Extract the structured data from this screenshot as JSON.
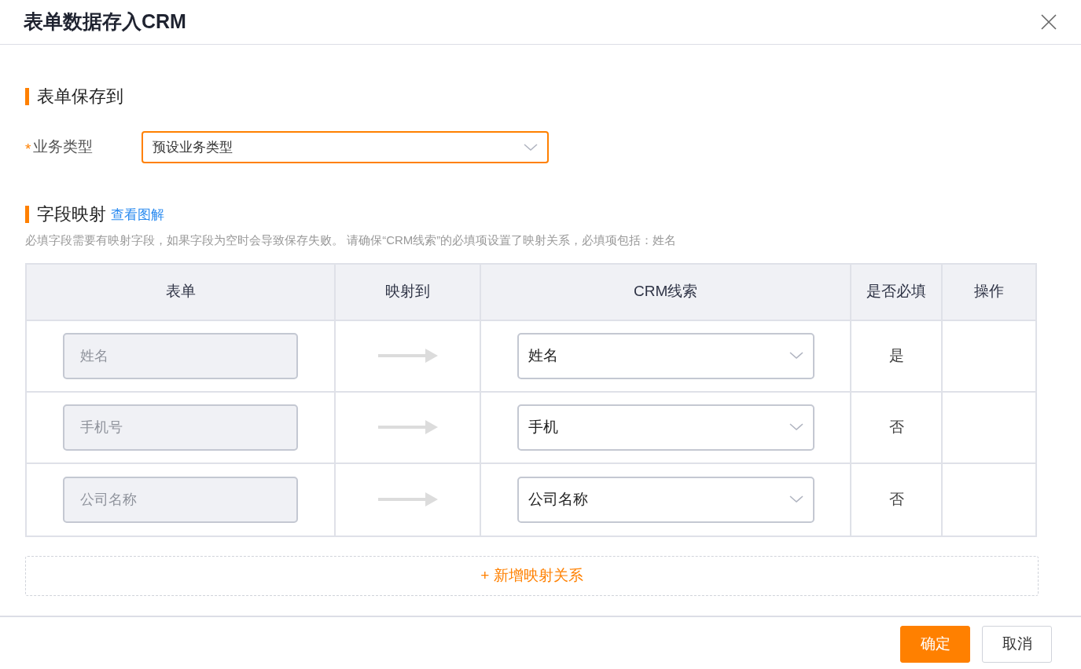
{
  "dialog": {
    "title": "表单数据存入CRM"
  },
  "save_section": {
    "heading": "表单保存到",
    "field": {
      "label": "业务类型",
      "required_mark": "*",
      "value": "预设业务类型",
      "focused": true
    }
  },
  "mapping_section": {
    "heading": "字段映射",
    "link": "查看图解",
    "note": "必填字段需要有映射字段，如果字段为空时会导致保存失败。 请确保“CRM线索”的必填项设置了映射关系，必填项包括：姓名"
  },
  "table": {
    "columns": [
      "表单",
      "映射到",
      "CRM线索",
      "是否必填",
      "操作"
    ],
    "rows": [
      {
        "form_field": "姓名",
        "disabled": true,
        "crm_field": "姓名",
        "required": "是"
      },
      {
        "form_field": "手机号",
        "disabled": true,
        "crm_field": "手机",
        "required": "否"
      },
      {
        "form_field": "公司名称",
        "disabled": true,
        "crm_field": "公司名称",
        "required": "否"
      }
    ]
  },
  "add_button": "+ 新增映射关系",
  "buttons": [
    {
      "label": "确定",
      "kind": "primary"
    },
    {
      "label": "取消",
      "kind": "secondary"
    }
  ]
}
